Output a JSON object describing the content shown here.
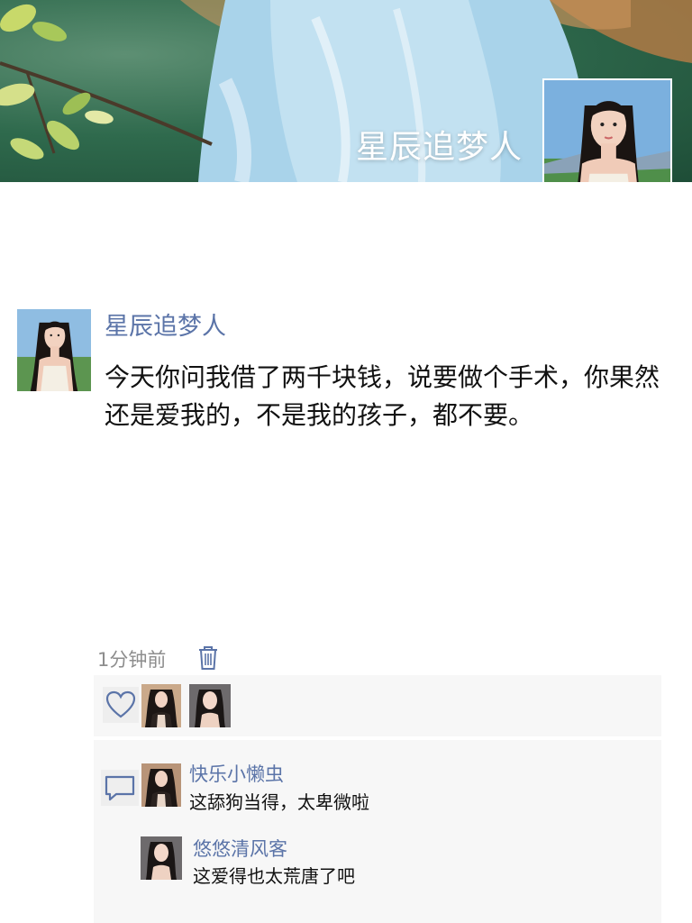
{
  "cover": {
    "username": "星辰追梦人"
  },
  "post": {
    "author": "星辰追梦人",
    "text": "今天你问我借了两千块钱，说要做个手术，你果然还是爱我的，不是我的孩子，都不要。",
    "time": "1分钟前"
  },
  "likes": {
    "icon": "heart-icon",
    "liker_count": 2
  },
  "comments": [
    {
      "author": "快乐小懒虫",
      "text": "这舔狗当得，太卑微啦"
    },
    {
      "author": "悠悠清风客",
      "text": "这爱得也太荒唐了吧"
    }
  ],
  "colors": {
    "name_link": "#5b74a8",
    "timestamp": "#8d8d8d",
    "panel_bg": "#f7f7f7"
  }
}
